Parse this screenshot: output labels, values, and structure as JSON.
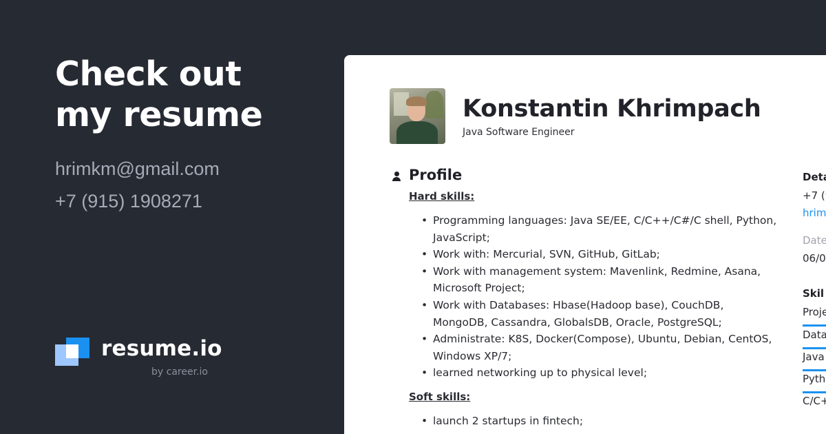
{
  "hero": {
    "headline_line1": "Check out",
    "headline_line2": "my resume",
    "email": "hrimkm@gmail.com",
    "phone": "+7 (915) 1908271"
  },
  "brand": {
    "name": "resume.io",
    "tagline": "by career.io"
  },
  "resume": {
    "name": "Konstantin Khrimpach",
    "job_title": "Java Software Engineer",
    "profile_title": "Profile",
    "hard_skills_title": "Hard skills:",
    "hard_skills": [
      "Programming languages: Java SE/EE, C/C++/C#/C shell, Python, JavaScript;",
      "Work with: Mercurial, SVN, GitHub, GitLab;",
      "Work with management system: Mavenlink, Redmine, Asana, Microsoft Project;",
      "Work with Databases: Hbase(Hadoop base), CouchDB, MongoDB, Cassandra, GlobalsDB, Oracle, PostgreSQL;",
      "Administrate: K8S, Docker(Compose), Ubuntu, Debian, CentOS, Windows XP/7;",
      "learned networking up to physical level;"
    ],
    "soft_skills_title": "Soft skills:",
    "soft_skills": [
      "launch 2 startups in fintech;"
    ],
    "sidebar": {
      "details_label": "Deta",
      "phone": "+7 (9",
      "email": "hrim",
      "date_label": "Date",
      "date": "06/0",
      "skills_label": "Skil",
      "skills": [
        "Proje",
        "Data",
        "Java",
        "Pyth",
        "C/C+"
      ]
    }
  },
  "colors": {
    "background": "#262a33",
    "accent": "#1a91f0",
    "muted_text": "#a6abb7"
  }
}
